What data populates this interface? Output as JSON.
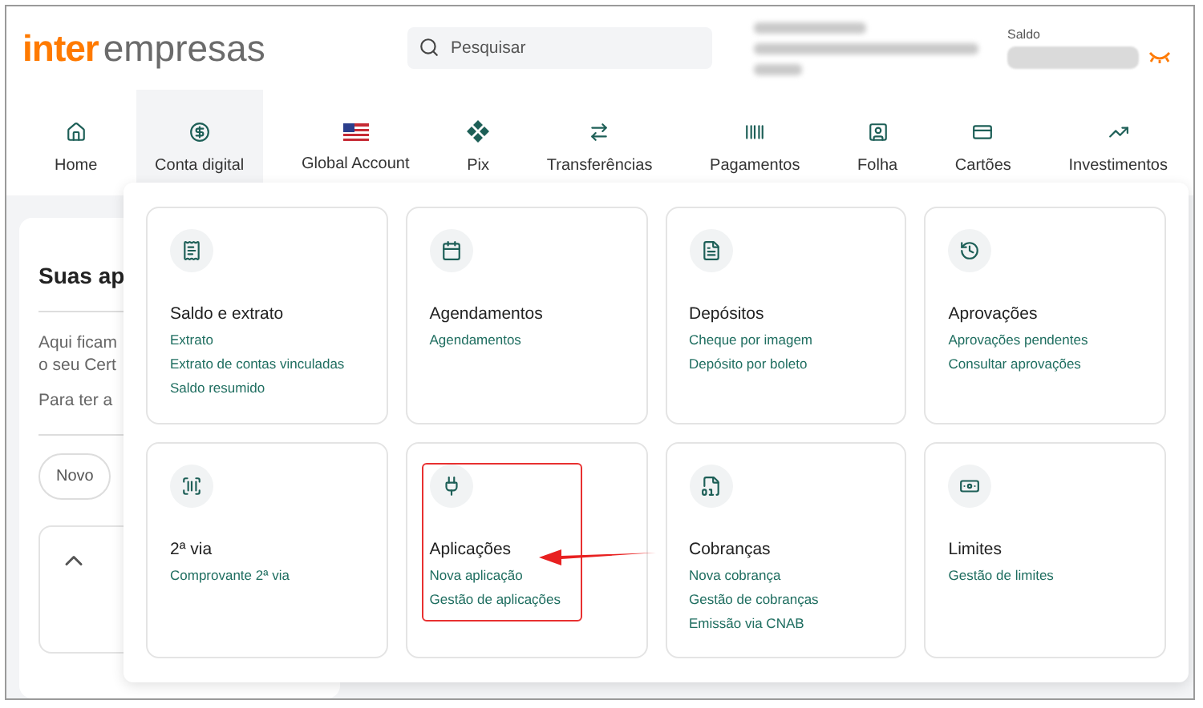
{
  "header": {
    "logo": {
      "brand": "inter",
      "product": "empresas"
    },
    "search": {
      "placeholder": "Pesquisar"
    },
    "balance": {
      "label": "Saldo"
    }
  },
  "nav": [
    {
      "label": "Home",
      "selected": false
    },
    {
      "label": "Conta digital",
      "selected": true
    },
    {
      "label": "Global Account",
      "selected": false
    },
    {
      "label": "Pix",
      "selected": false
    },
    {
      "label": "Transferências",
      "selected": false
    },
    {
      "label": "Pagamentos",
      "selected": false
    },
    {
      "label": "Folha",
      "selected": false
    },
    {
      "label": "Cartões",
      "selected": false
    },
    {
      "label": "Investimentos",
      "selected": false
    }
  ],
  "background_card": {
    "title": "Suas ap",
    "text_lines": [
      "Aqui ficam",
      "o seu Cert"
    ],
    "note": "Para ter a",
    "button": "Novo"
  },
  "menu_cards": [
    {
      "title": "Saldo e extrato",
      "links": [
        "Extrato",
        "Extrato de contas vinculadas",
        "Saldo resumido"
      ],
      "highlighted": false
    },
    {
      "title": "Agendamentos",
      "links": [
        "Agendamentos"
      ],
      "highlighted": false
    },
    {
      "title": "Depósitos",
      "links": [
        "Cheque por imagem",
        "Depósito por boleto"
      ],
      "highlighted": false
    },
    {
      "title": "Aprovações",
      "links": [
        "Aprovações pendentes",
        "Consultar aprovações"
      ],
      "highlighted": false
    },
    {
      "title": "2ª via",
      "links": [
        "Comprovante 2ª via"
      ],
      "highlighted": false
    },
    {
      "title": "Aplicações",
      "links": [
        "Nova aplicação",
        "Gestão de aplicações"
      ],
      "highlighted": true
    },
    {
      "title": "Cobranças",
      "links": [
        "Nova cobrança",
        "Gestão de cobranças",
        "Emissão via CNAB"
      ],
      "highlighted": false
    },
    {
      "title": "Limites",
      "links": [
        "Gestão de limites"
      ],
      "highlighted": false
    }
  ]
}
